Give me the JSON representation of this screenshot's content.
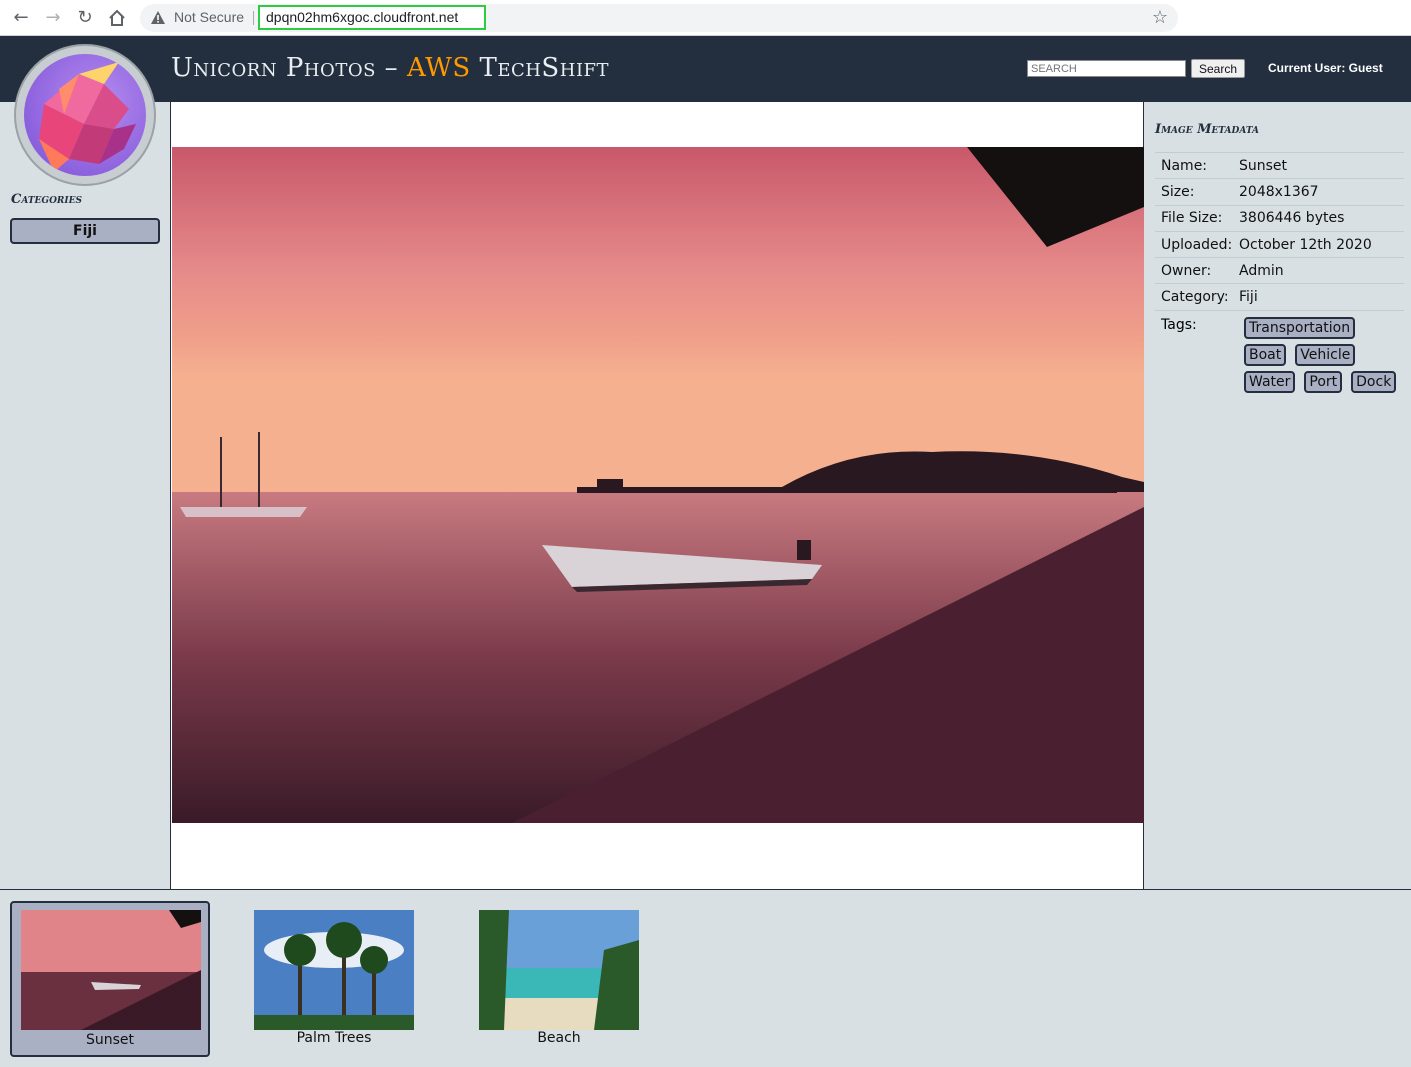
{
  "browser": {
    "security_label": "Not Secure",
    "url": "dpqn02hm6xgoc.cloudfront.net"
  },
  "header": {
    "title_main": "Unicorn Photos – ",
    "title_accent": "AWS ",
    "title_end": "TechShift",
    "search_placeholder": "SEARCH",
    "search_button": "Search",
    "current_user": "Current User: Guest"
  },
  "sidebar": {
    "heading": "Categories",
    "categories": [
      "Fiji"
    ]
  },
  "metadata": {
    "heading": "Image Metadata",
    "rows": [
      {
        "key": "Name:",
        "value": "Sunset"
      },
      {
        "key": "Size:",
        "value": "2048x1367"
      },
      {
        "key": "File Size:",
        "value": "3806446 bytes"
      },
      {
        "key": "Uploaded:",
        "value": "October 12th 2020"
      },
      {
        "key": "Owner:",
        "value": "Admin"
      },
      {
        "key": "Category:",
        "value": "Fiji"
      }
    ],
    "tags_label": "Tags:",
    "tags": [
      "Transportation",
      "Boat",
      "Vehicle",
      "Water",
      "Port",
      "Dock"
    ]
  },
  "thumbnails": [
    {
      "label": "Sunset",
      "selected": true
    },
    {
      "label": "Palm Trees",
      "selected": false
    },
    {
      "label": "Beach",
      "selected": false
    }
  ],
  "colors": {
    "header_bg": "#232f3e",
    "accent": "#ff9900",
    "panel_bg": "#d9e0e4",
    "tag_bg": "#a9b0c4"
  }
}
